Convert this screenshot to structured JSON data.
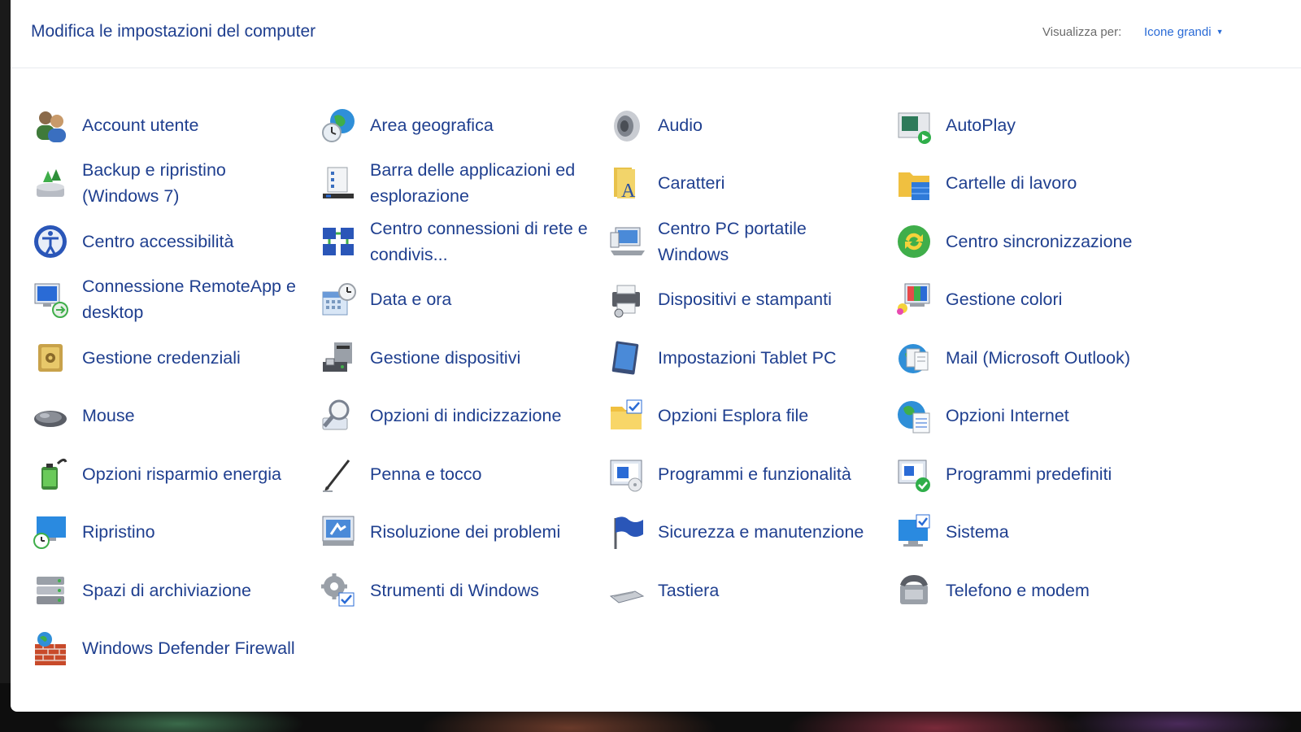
{
  "header": {
    "title": "Modifica le impostazioni del computer",
    "view_label": "Visualizza per:",
    "view_value": "Icone grandi"
  },
  "items": [
    {
      "label": "Account utente",
      "icon": "user-accounts-icon"
    },
    {
      "label": "Area geografica",
      "icon": "region-globe-icon"
    },
    {
      "label": "Audio",
      "icon": "speaker-icon"
    },
    {
      "label": "AutoPlay",
      "icon": "autoplay-icon"
    },
    {
      "label": "Backup e ripristino (Windows 7)",
      "icon": "backup-icon"
    },
    {
      "label": "Barra delle applicazioni ed esplorazione",
      "icon": "taskbar-icon"
    },
    {
      "label": "Caratteri",
      "icon": "fonts-icon"
    },
    {
      "label": "Cartelle di lavoro",
      "icon": "work-folders-icon"
    },
    {
      "label": "Centro accessibilità",
      "icon": "accessibility-icon"
    },
    {
      "label": "Centro connessioni di rete e condivis...",
      "icon": "network-icon"
    },
    {
      "label": "Centro PC portatile Windows",
      "icon": "mobility-center-icon"
    },
    {
      "label": "Centro sincronizzazione",
      "icon": "sync-icon"
    },
    {
      "label": "Connessione RemoteApp e desktop",
      "icon": "remoteapp-icon"
    },
    {
      "label": "Data e ora",
      "icon": "date-time-icon"
    },
    {
      "label": "Dispositivi e stampanti",
      "icon": "printer-icon"
    },
    {
      "label": "Gestione colori",
      "icon": "color-management-icon"
    },
    {
      "label": "Gestione credenziali",
      "icon": "credential-vault-icon"
    },
    {
      "label": "Gestione dispositivi",
      "icon": "device-manager-icon"
    },
    {
      "label": "Impostazioni Tablet PC",
      "icon": "tablet-icon"
    },
    {
      "label": "Mail (Microsoft Outlook)",
      "icon": "mail-icon"
    },
    {
      "label": "Mouse",
      "icon": "mouse-icon"
    },
    {
      "label": "Opzioni di indicizzazione",
      "icon": "indexing-icon"
    },
    {
      "label": "Opzioni Esplora file",
      "icon": "folder-options-icon"
    },
    {
      "label": "Opzioni Internet",
      "icon": "internet-options-icon"
    },
    {
      "label": "Opzioni risparmio energia",
      "icon": "power-icon"
    },
    {
      "label": "Penna e tocco",
      "icon": "pen-icon"
    },
    {
      "label": "Programmi e funzionalità",
      "icon": "programs-icon"
    },
    {
      "label": "Programmi predefiniti",
      "icon": "default-programs-icon"
    },
    {
      "label": "Ripristino",
      "icon": "recovery-icon"
    },
    {
      "label": "Risoluzione dei problemi",
      "icon": "troubleshooting-icon"
    },
    {
      "label": "Sicurezza e manutenzione",
      "icon": "security-flag-icon"
    },
    {
      "label": "Sistema",
      "icon": "system-icon"
    },
    {
      "label": "Spazi di archiviazione",
      "icon": "storage-spaces-icon"
    },
    {
      "label": "Strumenti di Windows",
      "icon": "windows-tools-icon"
    },
    {
      "label": "Tastiera",
      "icon": "keyboard-icon"
    },
    {
      "label": "Telefono e modem",
      "icon": "phone-modem-icon"
    },
    {
      "label": "Windows Defender Firewall",
      "icon": "firewall-icon"
    }
  ],
  "colors": {
    "link": "#1f3f8f",
    "accent": "#2a6bd6",
    "muted": "#6b6b6b"
  }
}
